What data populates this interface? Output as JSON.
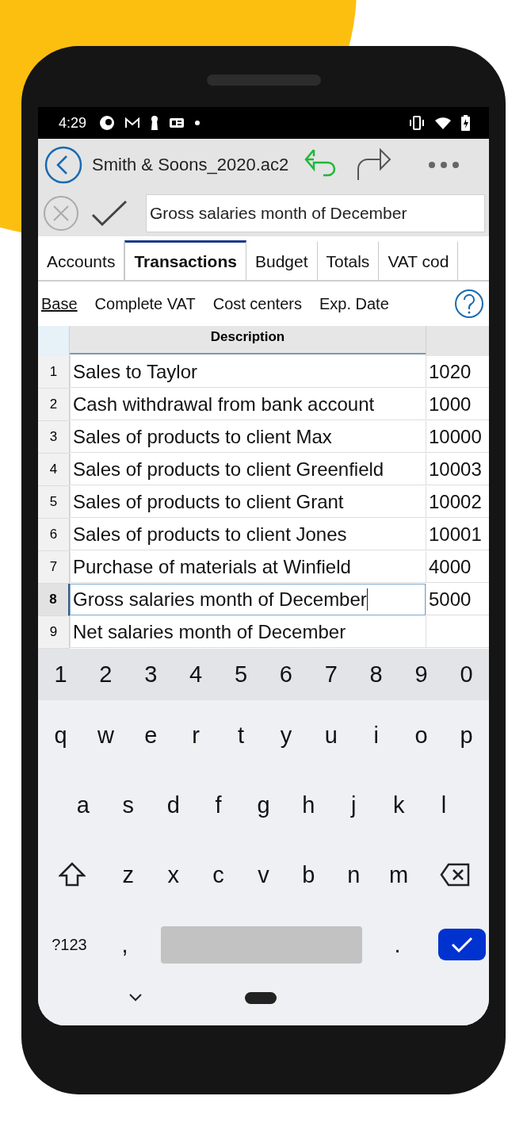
{
  "status_bar": {
    "time": "4:29"
  },
  "toolbar": {
    "title": "Smith & Soons_2020.ac2"
  },
  "edit_bar": {
    "value": "Gross salaries month of December"
  },
  "tabs": [
    {
      "label": "Accounts",
      "selected": false
    },
    {
      "label": "Transactions",
      "selected": true
    },
    {
      "label": "Budget",
      "selected": false
    },
    {
      "label": "Totals",
      "selected": false
    },
    {
      "label": "VAT cod",
      "selected": false
    }
  ],
  "views": [
    {
      "label": "Base",
      "selected": true
    },
    {
      "label": "Complete VAT",
      "selected": false
    },
    {
      "label": "Cost centers",
      "selected": false
    },
    {
      "label": "Exp. Date",
      "selected": false
    }
  ],
  "table": {
    "columns": [
      "Description"
    ],
    "rows": [
      {
        "number": "1",
        "description": "Sales to Taylor",
        "column_2": "1020",
        "selected": false
      },
      {
        "number": "2",
        "description": "Cash withdrawal from bank account",
        "column_2": "1000",
        "selected": false
      },
      {
        "number": "3",
        "description": "Sales of products to client Max",
        "column_2": "10000",
        "selected": false
      },
      {
        "number": "4",
        "description": "Sales of products to client Greenfield",
        "column_2": "10003",
        "selected": false
      },
      {
        "number": "5",
        "description": "Sales of products to client Grant",
        "column_2": "10002",
        "selected": false
      },
      {
        "number": "6",
        "description": "Sales of products to client Jones",
        "column_2": "10001",
        "selected": false
      },
      {
        "number": "7",
        "description": "Purchase of materials at Winfield",
        "column_2": "4000",
        "selected": false
      },
      {
        "number": "8",
        "description": "Gross salaries month of December",
        "column_2": "5000",
        "selected": true
      },
      {
        "number": "9",
        "description": "Net salaries month of December",
        "selected": false
      }
    ]
  },
  "keyboard": {
    "number_row": [
      "1",
      "2",
      "3",
      "4",
      "5",
      "6",
      "7",
      "8",
      "9",
      "0"
    ],
    "rows": [
      [
        "q",
        "w",
        "e",
        "r",
        "t",
        "y",
        "u",
        "i",
        "o",
        "p"
      ],
      [
        "a",
        "s",
        "d",
        "f",
        "g",
        "h",
        "j",
        "k",
        "l"
      ],
      [
        "z",
        "x",
        "c",
        "v",
        "b",
        "n",
        "m"
      ]
    ],
    "symbols_key": "?123",
    "comma_key": ",",
    "period_key": "."
  }
}
